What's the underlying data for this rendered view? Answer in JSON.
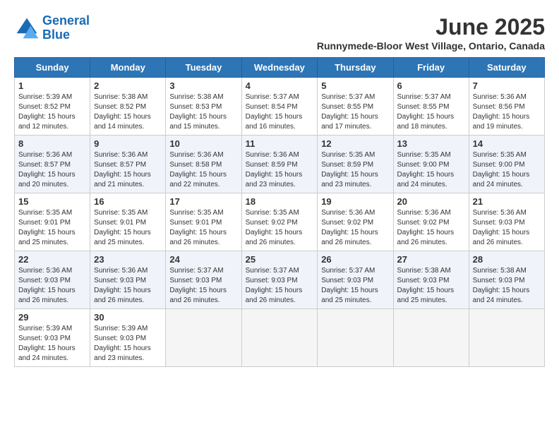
{
  "header": {
    "logo_line1": "General",
    "logo_line2": "Blue",
    "month": "June 2025",
    "location": "Runnymede-Bloor West Village, Ontario, Canada"
  },
  "weekdays": [
    "Sunday",
    "Monday",
    "Tuesday",
    "Wednesday",
    "Thursday",
    "Friday",
    "Saturday"
  ],
  "weeks": [
    [
      {
        "day": "1",
        "sunrise": "5:39 AM",
        "sunset": "8:52 PM",
        "daylight": "15 hours and 12 minutes."
      },
      {
        "day": "2",
        "sunrise": "5:38 AM",
        "sunset": "8:52 PM",
        "daylight": "15 hours and 14 minutes."
      },
      {
        "day": "3",
        "sunrise": "5:38 AM",
        "sunset": "8:53 PM",
        "daylight": "15 hours and 15 minutes."
      },
      {
        "day": "4",
        "sunrise": "5:37 AM",
        "sunset": "8:54 PM",
        "daylight": "15 hours and 16 minutes."
      },
      {
        "day": "5",
        "sunrise": "5:37 AM",
        "sunset": "8:55 PM",
        "daylight": "15 hours and 17 minutes."
      },
      {
        "day": "6",
        "sunrise": "5:37 AM",
        "sunset": "8:55 PM",
        "daylight": "15 hours and 18 minutes."
      },
      {
        "day": "7",
        "sunrise": "5:36 AM",
        "sunset": "8:56 PM",
        "daylight": "15 hours and 19 minutes."
      }
    ],
    [
      {
        "day": "8",
        "sunrise": "5:36 AM",
        "sunset": "8:57 PM",
        "daylight": "15 hours and 20 minutes."
      },
      {
        "day": "9",
        "sunrise": "5:36 AM",
        "sunset": "8:57 PM",
        "daylight": "15 hours and 21 minutes."
      },
      {
        "day": "10",
        "sunrise": "5:36 AM",
        "sunset": "8:58 PM",
        "daylight": "15 hours and 22 minutes."
      },
      {
        "day": "11",
        "sunrise": "5:36 AM",
        "sunset": "8:59 PM",
        "daylight": "15 hours and 23 minutes."
      },
      {
        "day": "12",
        "sunrise": "5:35 AM",
        "sunset": "8:59 PM",
        "daylight": "15 hours and 23 minutes."
      },
      {
        "day": "13",
        "sunrise": "5:35 AM",
        "sunset": "9:00 PM",
        "daylight": "15 hours and 24 minutes."
      },
      {
        "day": "14",
        "sunrise": "5:35 AM",
        "sunset": "9:00 PM",
        "daylight": "15 hours and 24 minutes."
      }
    ],
    [
      {
        "day": "15",
        "sunrise": "5:35 AM",
        "sunset": "9:01 PM",
        "daylight": "15 hours and 25 minutes."
      },
      {
        "day": "16",
        "sunrise": "5:35 AM",
        "sunset": "9:01 PM",
        "daylight": "15 hours and 25 minutes."
      },
      {
        "day": "17",
        "sunrise": "5:35 AM",
        "sunset": "9:01 PM",
        "daylight": "15 hours and 26 minutes."
      },
      {
        "day": "18",
        "sunrise": "5:35 AM",
        "sunset": "9:02 PM",
        "daylight": "15 hours and 26 minutes."
      },
      {
        "day": "19",
        "sunrise": "5:36 AM",
        "sunset": "9:02 PM",
        "daylight": "15 hours and 26 minutes."
      },
      {
        "day": "20",
        "sunrise": "5:36 AM",
        "sunset": "9:02 PM",
        "daylight": "15 hours and 26 minutes."
      },
      {
        "day": "21",
        "sunrise": "5:36 AM",
        "sunset": "9:03 PM",
        "daylight": "15 hours and 26 minutes."
      }
    ],
    [
      {
        "day": "22",
        "sunrise": "5:36 AM",
        "sunset": "9:03 PM",
        "daylight": "15 hours and 26 minutes."
      },
      {
        "day": "23",
        "sunrise": "5:36 AM",
        "sunset": "9:03 PM",
        "daylight": "15 hours and 26 minutes."
      },
      {
        "day": "24",
        "sunrise": "5:37 AM",
        "sunset": "9:03 PM",
        "daylight": "15 hours and 26 minutes."
      },
      {
        "day": "25",
        "sunrise": "5:37 AM",
        "sunset": "9:03 PM",
        "daylight": "15 hours and 26 minutes."
      },
      {
        "day": "26",
        "sunrise": "5:37 AM",
        "sunset": "9:03 PM",
        "daylight": "15 hours and 25 minutes."
      },
      {
        "day": "27",
        "sunrise": "5:38 AM",
        "sunset": "9:03 PM",
        "daylight": "15 hours and 25 minutes."
      },
      {
        "day": "28",
        "sunrise": "5:38 AM",
        "sunset": "9:03 PM",
        "daylight": "15 hours and 24 minutes."
      }
    ],
    [
      {
        "day": "29",
        "sunrise": "5:39 AM",
        "sunset": "9:03 PM",
        "daylight": "15 hours and 24 minutes."
      },
      {
        "day": "30",
        "sunrise": "5:39 AM",
        "sunset": "9:03 PM",
        "daylight": "15 hours and 23 minutes."
      },
      null,
      null,
      null,
      null,
      null
    ]
  ]
}
